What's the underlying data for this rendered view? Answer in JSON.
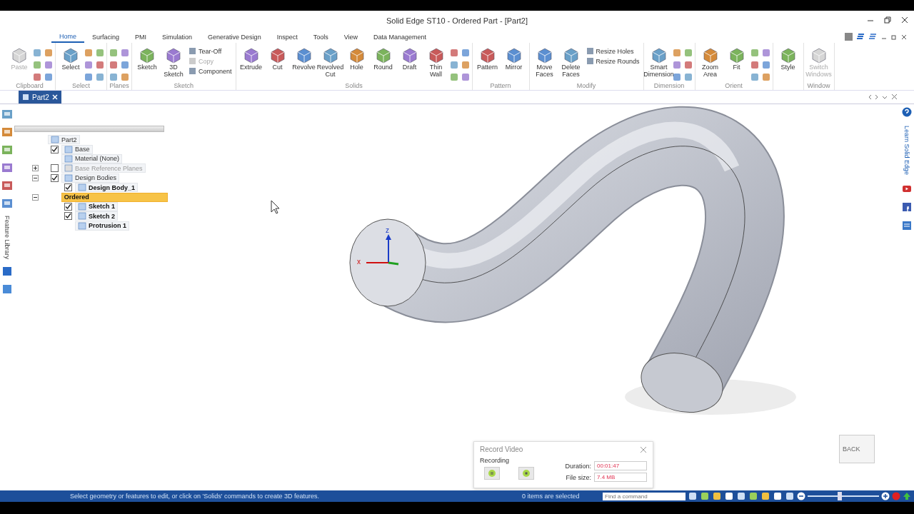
{
  "window": {
    "title": "Solid Edge ST10 - Ordered Part - [Part2]"
  },
  "ribbon": {
    "tabs": [
      {
        "label": "Home",
        "selected": true
      },
      {
        "label": "Surfacing",
        "selected": false
      },
      {
        "label": "PMI",
        "selected": false
      },
      {
        "label": "Simulation",
        "selected": false
      },
      {
        "label": "Generative Design",
        "selected": false
      },
      {
        "label": "Inspect",
        "selected": false
      },
      {
        "label": "Tools",
        "selected": false
      },
      {
        "label": "View",
        "selected": false
      },
      {
        "label": "Data Management",
        "selected": false
      }
    ],
    "groups": [
      {
        "label": "Clipboard",
        "kind": "tools-grid",
        "buttons": [
          {
            "label": "Paste",
            "kind": "large",
            "disabled": true
          }
        ]
      },
      {
        "label": "Select",
        "kind": "tools-grid",
        "buttons": [
          {
            "label": "Select",
            "kind": "large",
            "disabled": false
          }
        ]
      },
      {
        "label": "Planes",
        "kind": "tools-grid"
      },
      {
        "label": "Sketch",
        "kind": "tools",
        "buttons": [
          {
            "label": "Sketch",
            "kind": "large",
            "disabled": false
          },
          {
            "label": "3D Sketch",
            "kind": "large",
            "disabled": false
          },
          {
            "label": "Tear-Off",
            "kind": "small",
            "disabled": false
          },
          {
            "label": "Copy",
            "kind": "small",
            "disabled": true
          },
          {
            "label": "Component",
            "kind": "small",
            "disabled": false
          }
        ]
      },
      {
        "label": "Solids",
        "kind": "tools-grid",
        "buttons": [
          {
            "label": "Extrude",
            "kind": "large",
            "disabled": false
          },
          {
            "label": "Cut",
            "kind": "large",
            "disabled": false
          },
          {
            "label": "Revolve",
            "kind": "large",
            "disabled": false
          },
          {
            "label": "Revolved Cut",
            "kind": "large",
            "disabled": false
          },
          {
            "label": "Hole",
            "kind": "large",
            "disabled": false
          },
          {
            "label": "Round",
            "kind": "large",
            "disabled": false
          },
          {
            "label": "Draft",
            "kind": "large",
            "disabled": false
          },
          {
            "label": "Thin Wall",
            "kind": "large",
            "disabled": false
          }
        ]
      },
      {
        "label": "Pattern",
        "kind": "tools",
        "buttons": [
          {
            "label": "Pattern",
            "kind": "large",
            "disabled": false
          },
          {
            "label": "Mirror",
            "kind": "large",
            "disabled": false
          }
        ]
      },
      {
        "label": "Modify",
        "kind": "tools",
        "buttons": [
          {
            "label": "Move Faces",
            "kind": "large",
            "disabled": false
          },
          {
            "label": "Delete Faces",
            "kind": "large",
            "disabled": false
          },
          {
            "label": "Resize Holes",
            "kind": "small",
            "disabled": false
          },
          {
            "label": "Resize Rounds",
            "kind": "small",
            "disabled": false
          }
        ]
      },
      {
        "label": "Dimension",
        "kind": "tools-grid",
        "buttons": [
          {
            "label": "Smart Dimension",
            "kind": "large",
            "disabled": false
          }
        ]
      },
      {
        "label": "Orient",
        "kind": "tools-grid",
        "buttons": [
          {
            "label": "Zoom Area",
            "kind": "large",
            "disabled": false
          },
          {
            "label": "Fit",
            "kind": "large",
            "disabled": false
          }
        ]
      },
      {
        "kind": "tools",
        "buttons": [
          {
            "label": "Style",
            "kind": "large",
            "disabled": false
          }
        ]
      },
      {
        "label": "Window",
        "kind": "tools",
        "buttons": [
          {
            "label": "Switch Windows",
            "kind": "large",
            "disabled": true
          }
        ]
      }
    ]
  },
  "document_tab": {
    "label": "Part2"
  },
  "left_strip": {
    "label": "Feature Library"
  },
  "right_strip": {
    "label": "Learn Solid Edge"
  },
  "tree": [
    {
      "label": "Part2",
      "selected": false,
      "disabled": false,
      "children": [
        {
          "label": "Base",
          "checked": true,
          "selected": false,
          "disabled": false
        },
        {
          "label": "Material (None)",
          "selected": false,
          "disabled": false
        },
        {
          "label": "Base Reference Planes",
          "checked": false,
          "expanded": false,
          "selected": false,
          "disabled": true
        },
        {
          "label": "Design Bodies",
          "checked": true,
          "expanded": true,
          "selected": false,
          "disabled": false,
          "children": [
            {
              "label": "Design Body_1",
              "checked": true,
              "selected": false,
              "disabled": false
            }
          ]
        },
        {
          "label": "Ordered",
          "expanded": true,
          "selected": true,
          "disabled": false,
          "children": [
            {
              "label": "Sketch 1",
              "checked": true,
              "selected": false,
              "disabled": false
            },
            {
              "label": "Sketch 2",
              "checked": true,
              "selected": false,
              "disabled": false
            },
            {
              "label": "Protrusion 1",
              "selected": false,
              "disabled": false
            }
          ]
        }
      ]
    }
  ],
  "view": {
    "triad_labels": [
      "z",
      "x"
    ],
    "view_cube_label": "BACK"
  },
  "record_dialog": {
    "title": "Recording",
    "window_title": "Record Video",
    "duration_label": "Duration:",
    "duration": "00:01:47",
    "size_label": "File size:",
    "size": "7.4 MB"
  },
  "status_bar": {
    "message": "Select geometry or features to edit, or click on 'Solids' commands to create 3D features.",
    "selection": "0 items are selected",
    "search": {
      "placeholder": "Find a command"
    },
    "zoom_slider": {
      "level": 0.45
    }
  }
}
